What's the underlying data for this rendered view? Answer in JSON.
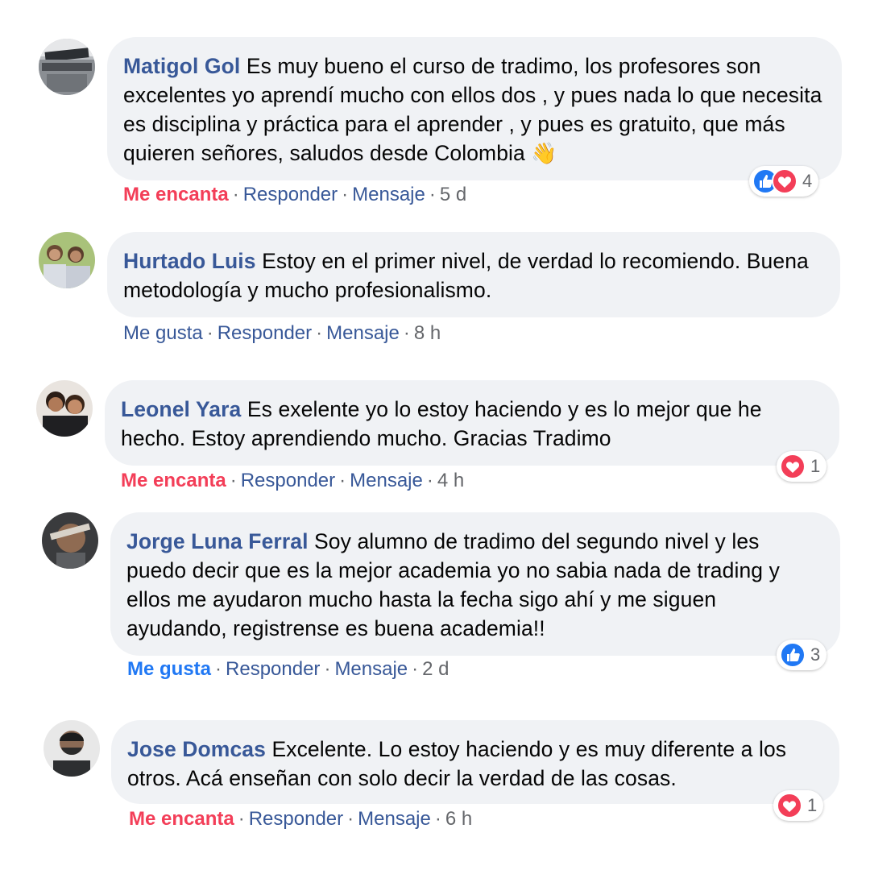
{
  "comments": [
    {
      "author": "Matigol Gol",
      "text": "Es muy bueno el curso de tradimo, los profesores son excelentes yo aprendí mucho con ellos dos , y pues nada lo que necesita es disciplina y práctica para el aprender , y pues es gratuito, que más quieren señores, saludos desde Colombia",
      "emoji": "👋",
      "reaction_label": "Me encanta",
      "reply": "Responder",
      "message": "Mensaje",
      "time": "5 d",
      "reaction_count": "4",
      "reaction_icons": [
        "like-icon",
        "love-icon"
      ]
    },
    {
      "author": "Hurtado Luis",
      "text": "Estoy en el primer nivel, de verdad lo recomiendo. Buena metodología y mucho profesionalismo.",
      "reaction_label": "Me gusta",
      "reply": "Responder",
      "message": "Mensaje",
      "time": "8 h"
    },
    {
      "author": "Leonel Yara",
      "text": "Es exelente yo lo estoy haciendo y es lo mejor que he hecho. Estoy aprendiendo mucho. Gracias Tradimo",
      "reaction_label": "Me encanta",
      "reply": "Responder",
      "message": "Mensaje",
      "time": "4 h",
      "reaction_count": "1",
      "reaction_icons": [
        "love-icon"
      ]
    },
    {
      "author": "Jorge Luna Ferral",
      "text": "Soy alumno de tradimo del segundo nivel y les puedo decir que es la mejor academia yo no sabia nada de trading y ellos me ayudaron mucho hasta la fecha sigo ahí y me siguen ayudando, registrense es buena academia!!",
      "reaction_label": "Me gusta",
      "reply": "Responder",
      "message": "Mensaje",
      "time": "2 d",
      "reaction_count": "3",
      "reaction_icons": [
        "like-icon"
      ]
    },
    {
      "author": "Jose Domcas",
      "text": "Excelente. Lo estoy haciendo y es muy diferente a los otros. Acá enseñan con solo decir la verdad de las cosas.",
      "reaction_label": "Me encanta",
      "reply": "Responder",
      "message": "Mensaje",
      "time": "6 h",
      "reaction_count": "1",
      "reaction_icons": [
        "love-icon"
      ]
    }
  ],
  "colors": {
    "bubble_bg": "#f0f2f5",
    "author": "#385898",
    "love": "#f33e58",
    "like": "#2078f4",
    "meta": "#65676b"
  }
}
